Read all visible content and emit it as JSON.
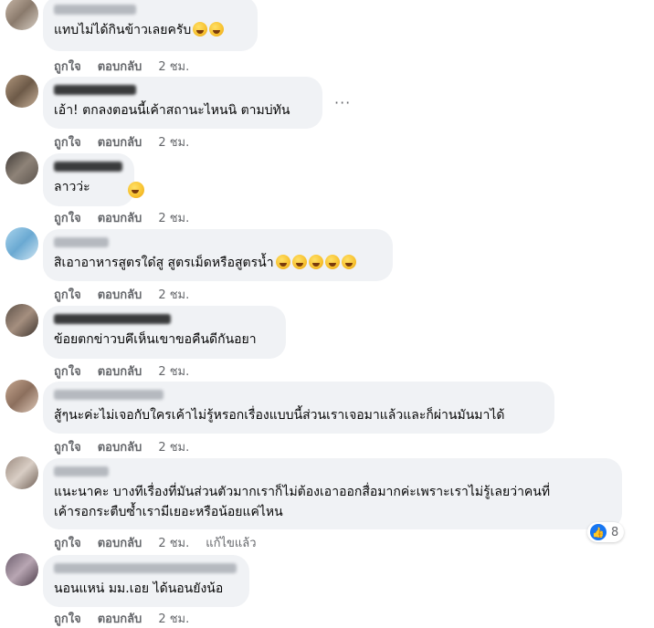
{
  "comments": [
    {
      "text": "แทบไม่ได้กินข้าวเลยครับ",
      "emoji_count": 2,
      "like_label": "ถูกใจ",
      "reply_label": "ตอบกลับ",
      "time": "2 ชม."
    },
    {
      "text": "เอ้า! ตกลงตอนนี้เค้าสถานะไหนนิ ตามบ่ทัน",
      "emoji_count": 0,
      "like_label": "ถูกใจ",
      "reply_label": "ตอบกลับ",
      "time": "2 ชม."
    },
    {
      "text": "ลาวว่ะ",
      "emoji_count": 1,
      "like_label": "ถูกใจ",
      "reply_label": "ตอบกลับ",
      "time": "2 ชม."
    },
    {
      "text": "สิเอาอาหารสูตรใด๋สู สูตรเม็ดหรือสูตรน้ำ",
      "emoji_count": 5,
      "like_label": "ถูกใจ",
      "reply_label": "ตอบกลับ",
      "time": "2 ชม."
    },
    {
      "text": "ข้อยตกข่าวบคึเห็นเขาขอคืนดีกันอยา",
      "emoji_count": 0,
      "like_label": "ถูกใจ",
      "reply_label": "ตอบกลับ",
      "time": "2 ชม."
    },
    {
      "text": "สู้ๆนะค่ะไม่เจอกับใครเค้าไม่รู้หรอกเรื่องแบบนี้ส่วนเราเจอมาแล้วและก็ผ่านมันมาได้",
      "emoji_count": 0,
      "like_label": "ถูกใจ",
      "reply_label": "ตอบกลับ",
      "time": "2 ชม."
    },
    {
      "text_line1": "แนะนาคะ บางทีเรื่องที่มันส่วนตัวมากเราก็ไม่ต้องเอาออกสื่อมากค่ะเพราะเราไม่รู้เลยว่าคนที่",
      "text_line2": "เค้ารอกระตืบซ้ำเรามีเยอะหรือน้อยแค่ไหน",
      "emoji_count": 0,
      "like_label": "ถูกใจ",
      "reply_label": "ตอบกลับ",
      "time": "2 ชม.",
      "edited_label": "แก้ไขแล้ว",
      "reaction_count": "8"
    },
    {
      "text": "นอนแหน่ มม.เอย ได้นอนยังน้อ",
      "emoji_count": 0,
      "like_label": "ถูกใจ",
      "reply_label": "ตอบกลับ",
      "time": "2 ชม."
    }
  ],
  "more_options": "···",
  "reaction_icon": "like-icon",
  "colors": {
    "bubble": "#f0f2f5",
    "meta_text": "#65676b",
    "like_blue": "#1877f2"
  }
}
